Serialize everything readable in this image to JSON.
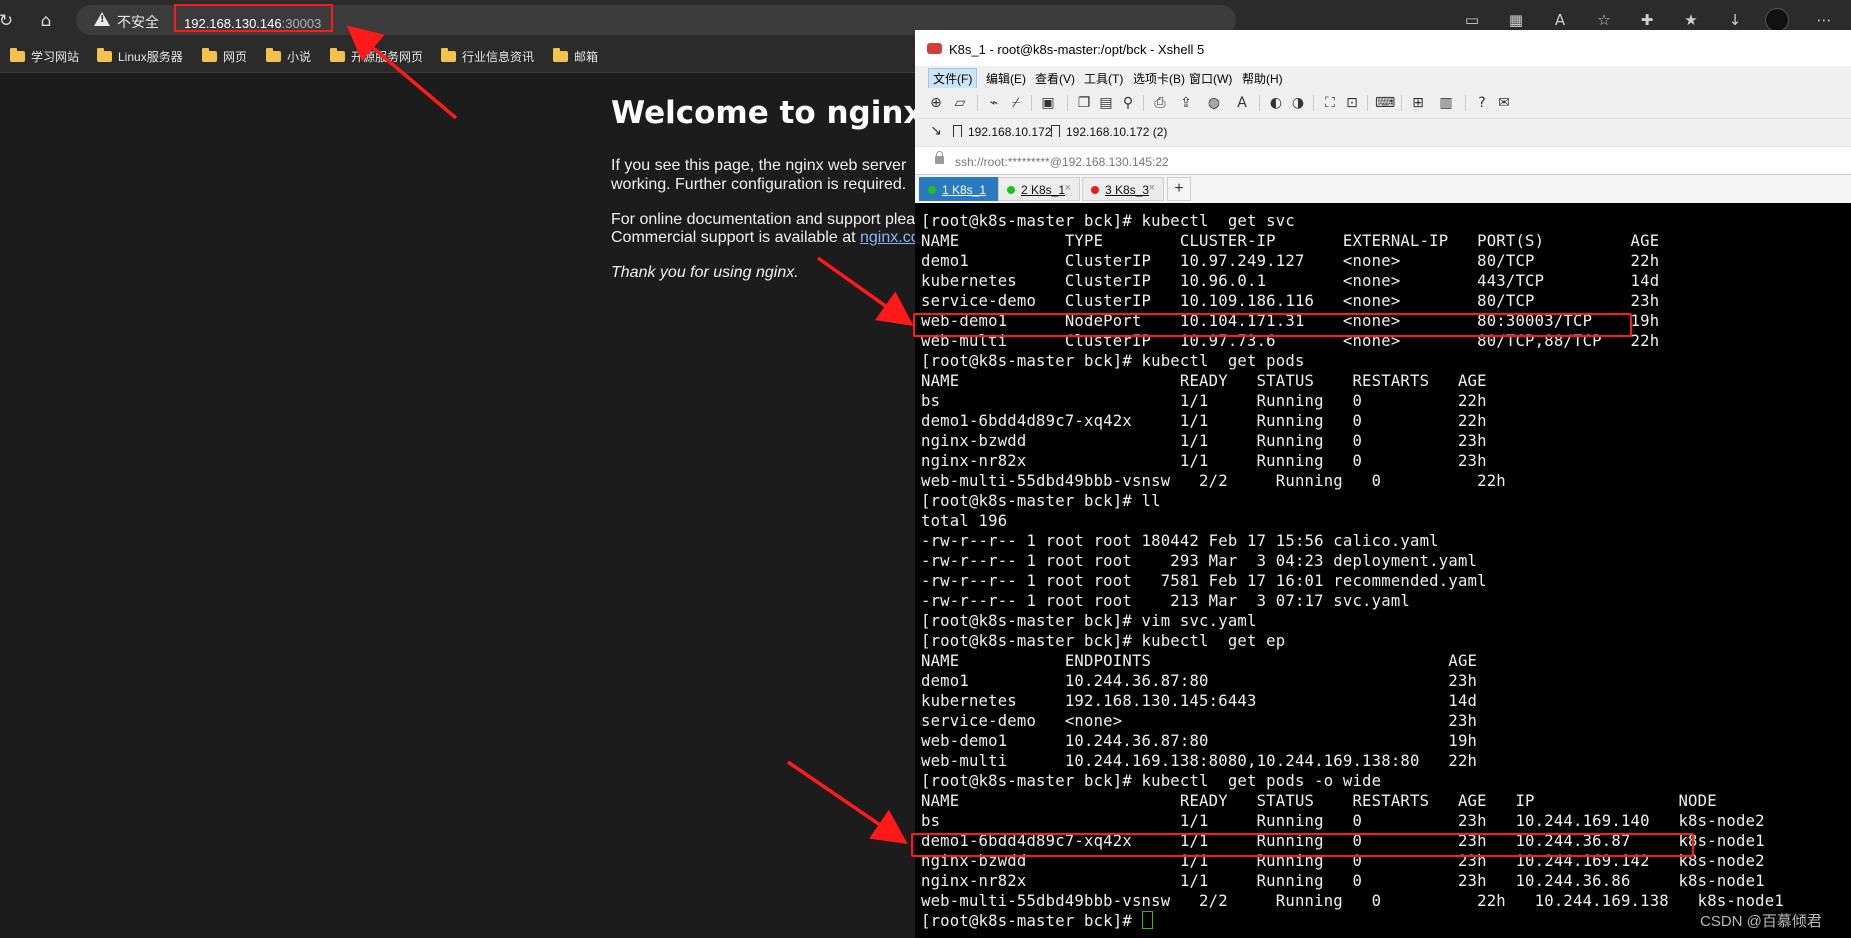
{
  "browser": {
    "nav": {
      "refresh_glyph": "↻",
      "home_glyph": "⌂"
    },
    "address_bar": {
      "security_label": "不安全",
      "url_host": "192.168.130.146",
      "url_port": ":30003"
    },
    "toolbar_icons": [
      "reading-view-icon",
      "qr-code-icon",
      "read-aloud-icon",
      "add-favorite-icon",
      "extensions-icon",
      "favorites-icon",
      "downloads-icon",
      "profile-avatar",
      "more-icon"
    ],
    "bookmarks": [
      "学习网站",
      "Linux服务器",
      "网页",
      "小说",
      "开源服务网页",
      "行业信息资讯",
      "邮箱"
    ]
  },
  "nginx": {
    "title": "Welcome to nginx!",
    "p1_line1": "If you see this page, the nginx web server",
    "p1_line2": "working. Further configuration is required.",
    "p2_line1": "For online documentation and support plea",
    "p2_line2": "Commercial support is available at ",
    "p2_link": "nginx.co",
    "thanks": "Thank you for using nginx."
  },
  "xshell": {
    "title": "K8s_1 - root@k8s-master:/opt/bck - Xshell 5",
    "menu": [
      "文件(F)",
      "编辑(E)",
      "查看(V)",
      "工具(T)",
      "选项卡(B)",
      "窗口(W)",
      "帮助(H)"
    ],
    "sessions": [
      "192.168.10.172",
      "192.168.10.172 (2)"
    ],
    "address": "ssh://root:*********@192.168.130.145:22",
    "tabs": [
      {
        "label": "1 K8s_1",
        "color": "#1ec41e",
        "close": "×"
      },
      {
        "label": "2 K8s_1",
        "color": "#1ec41e",
        "close": "×"
      },
      {
        "label": "3 K8s_3",
        "color": "#e81d1d",
        "close": "×"
      }
    ],
    "tab_add": "+",
    "terminal_lines": [
      "[root@k8s-master bck]# kubectl  get svc",
      "NAME           TYPE        CLUSTER-IP       EXTERNAL-IP   PORT(S)         AGE",
      "demo1          ClusterIP   10.97.249.127    <none>        80/TCP          22h",
      "kubernetes     ClusterIP   10.96.0.1        <none>        443/TCP         14d",
      "service-demo   ClusterIP   10.109.186.116   <none>        80/TCP          23h",
      "web-demo1      NodePort    10.104.171.31    <none>        80:30003/TCP    19h",
      "web-multi      ClusterIP   10.97.73.6       <none>        80/TCP,88/TCP   22h",
      "[root@k8s-master bck]# kubectl  get pods",
      "NAME                       READY   STATUS    RESTARTS   AGE",
      "bs                         1/1     Running   0          22h",
      "demo1-6bdd4d89c7-xq42x     1/1     Running   0          22h",
      "nginx-bzwdd                1/1     Running   0          23h",
      "nginx-nr82x                1/1     Running   0          23h",
      "web-multi-55dbd49bbb-vsnsw   2/2     Running   0          22h",
      "[root@k8s-master bck]# ll",
      "total 196",
      "-rw-r--r-- 1 root root 180442 Feb 17 15:56 calico.yaml",
      "-rw-r--r-- 1 root root    293 Mar  3 04:23 deployment.yaml",
      "-rw-r--r-- 1 root root   7581 Feb 17 16:01 recommended.yaml",
      "-rw-r--r-- 1 root root    213 Mar  3 07:17 svc.yaml",
      "[root@k8s-master bck]# vim svc.yaml",
      "[root@k8s-master bck]# kubectl  get ep",
      "NAME           ENDPOINTS                               AGE",
      "demo1          10.244.36.87:80                         23h",
      "kubernetes     192.168.130.145:6443                    14d",
      "service-demo   <none>                                  23h",
      "web-demo1      10.244.36.87:80                         19h",
      "web-multi      10.244.169.138:8080,10.244.169.138:80   22h",
      "[root@k8s-master bck]# kubectl  get pods -o wide",
      "NAME                       READY   STATUS    RESTARTS   AGE   IP               NODE",
      "bs                         1/1     Running   0          23h   10.244.169.140   k8s-node2",
      "demo1-6bdd4d89c7-xq42x     1/1     Running   0          23h   10.244.36.87     k8s-node1",
      "nginx-bzwdd                1/1     Running   0          23h   10.244.169.142   k8s-node2",
      "nginx-nr82x                1/1     Running   0          23h   10.244.36.86     k8s-node1",
      "web-multi-55dbd49bbb-vsnsw   2/2     Running   0          22h   10.244.169.138   k8s-node1"
    ],
    "prompt_last": "[root@k8s-master bck]# "
  },
  "watermark": "CSDN @百慕倾君",
  "colors": {
    "highlight": "#ff1a1a",
    "cursor": "#1ec41e"
  }
}
